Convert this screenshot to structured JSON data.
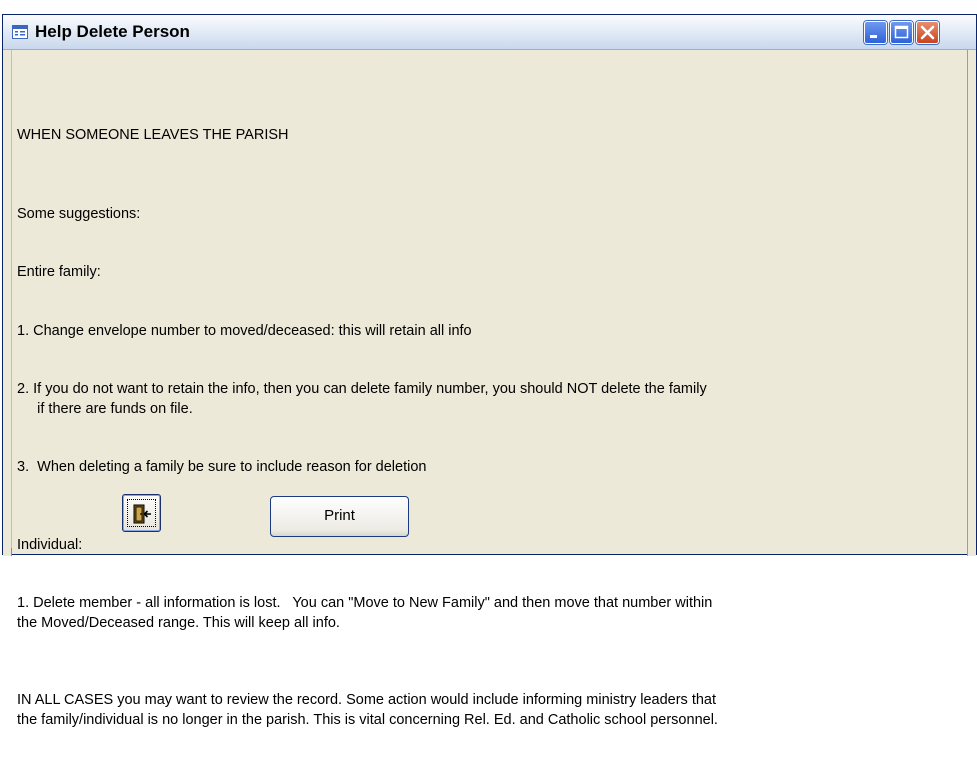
{
  "window": {
    "title": "Help Delete Person",
    "icon": "form-icon"
  },
  "controls": {
    "minimize_icon": "minimize-icon",
    "maximize_icon": "maximize-icon",
    "close_icon": "close-icon"
  },
  "content": {
    "heading": "WHEN SOMEONE LEAVES THE PARISH",
    "suggestions_label": "Some suggestions:",
    "family_label": "Entire family:",
    "family_item_1": "1. Change envelope number to moved/deceased: this will retain all info",
    "family_item_2": "2. If you do not want to retain the info, then you can delete family number, you should NOT delete the family\n     if there are funds on file.",
    "family_item_3": "3.  When deleting a family be sure to include reason for deletion",
    "individual_label": "Individual:",
    "individual_item_1": "1. Delete member - all information is lost.   You can \"Move to New Family\" and then move that number within\nthe Moved/Deceased range. This will keep all info.",
    "all_cases": "IN ALL CASES you may want to review the record. Some action would include informing ministry leaders that\nthe family/individual is no longer in the parish. This is vital concerning Rel. Ed. and Catholic school personnel."
  },
  "buttons": {
    "exit_icon": "exit-door-icon",
    "print_label": "Print"
  }
}
